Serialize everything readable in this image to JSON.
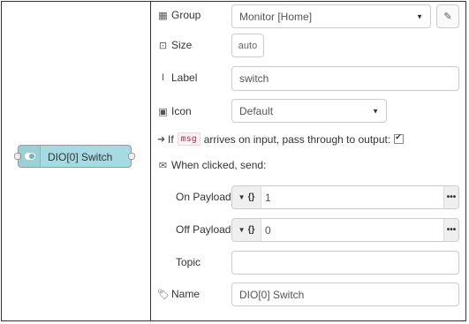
{
  "node": {
    "label": "DIO[0] Switch"
  },
  "form": {
    "group": {
      "label": "Group",
      "value": "Monitor [Home]"
    },
    "size": {
      "label": "Size",
      "value": "auto"
    },
    "label": {
      "label": "Label",
      "value": "switch"
    },
    "icon": {
      "label": "Icon",
      "value": "Default"
    },
    "passthrough": {
      "prefix": "If",
      "code": "msg",
      "suffix": "arrives on input, pass through to output:",
      "checked": true
    },
    "when_clicked": {
      "label": "When clicked, send:"
    },
    "on_payload": {
      "label": "On Payload",
      "type": "{}",
      "value": "1"
    },
    "off_payload": {
      "label": "Off Payload",
      "type": "{}",
      "value": "0"
    },
    "topic": {
      "label": "Topic",
      "value": ""
    },
    "name": {
      "label": "Name",
      "value": "DIO[0] Switch"
    }
  },
  "icons": [
    "table-icon",
    "size-icon",
    "text-cursor-icon",
    "image-icon",
    "arrow-right-icon",
    "envelope-icon",
    "tag-icon",
    "pencil-icon",
    "caret-down-icon",
    "ellipsis-icon"
  ]
}
